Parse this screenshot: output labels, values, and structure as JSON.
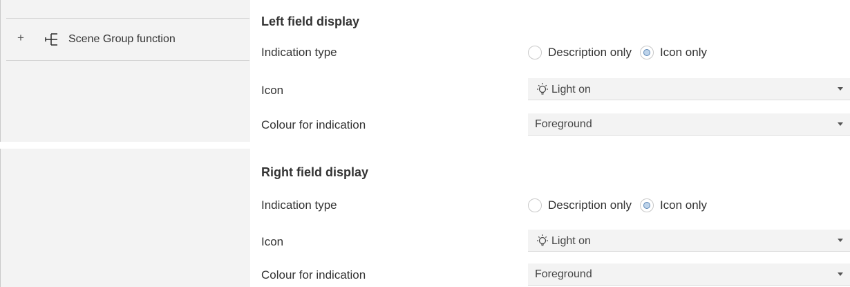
{
  "sidebar": {
    "expand_symbol": "+",
    "items": [
      {
        "label": "Scene Group function",
        "icon": "tree-branch-icon"
      }
    ]
  },
  "sections": [
    {
      "heading": "Left field display",
      "indication_type": {
        "label": "Indication type",
        "options": [
          "Description only",
          "Icon only"
        ],
        "selected": "Icon only"
      },
      "icon": {
        "label": "Icon",
        "value": "Light on",
        "value_icon": "light-bulb-icon"
      },
      "colour": {
        "label": "Colour for indication",
        "value": "Foreground"
      }
    },
    {
      "heading": "Right field display",
      "indication_type": {
        "label": "Indication type",
        "options": [
          "Description only",
          "Icon only"
        ],
        "selected": "Icon only"
      },
      "icon": {
        "label": "Icon",
        "value": "Light on",
        "value_icon": "light-bulb-icon"
      },
      "colour": {
        "label": "Colour for indication",
        "value": "Foreground"
      }
    }
  ],
  "colors": {
    "sidebar_background": "#f3f3f3",
    "dropdown_background": "#f3f3f3",
    "radio_selected_fill": "#bdd3ea",
    "radio_selected_border": "#5b86b5",
    "text": "#333333"
  }
}
